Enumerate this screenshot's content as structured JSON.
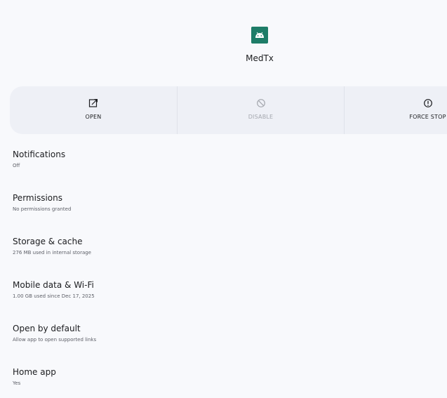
{
  "app": {
    "name": "MedTx",
    "icon": "android-app-icon"
  },
  "actions": {
    "open": {
      "label": "OPEN",
      "icon": "open-in-new-icon"
    },
    "disable": {
      "label": "DISABLE",
      "icon": "disable-icon",
      "enabled": false
    },
    "force_stop": {
      "label": "FORCE STOP",
      "icon": "info-alert-icon"
    }
  },
  "settings": [
    {
      "title": "Notifications",
      "summary": "Off"
    },
    {
      "title": "Permissions",
      "summary": "No permissions granted"
    },
    {
      "title": "Storage & cache",
      "summary": "276 MB used in internal storage"
    },
    {
      "title": "Mobile data & Wi-Fi",
      "summary": "1.00 GB used since Dec 17, 2025"
    },
    {
      "title": "Open by default",
      "summary": "Allow app to open supported links"
    },
    {
      "title": "Home app",
      "summary": "Yes"
    }
  ],
  "colors": {
    "background": "#f8f9fc",
    "action_bar": "#eef0f6",
    "app_icon": "#1e7d68",
    "disabled_text": "#a4a7ae"
  }
}
